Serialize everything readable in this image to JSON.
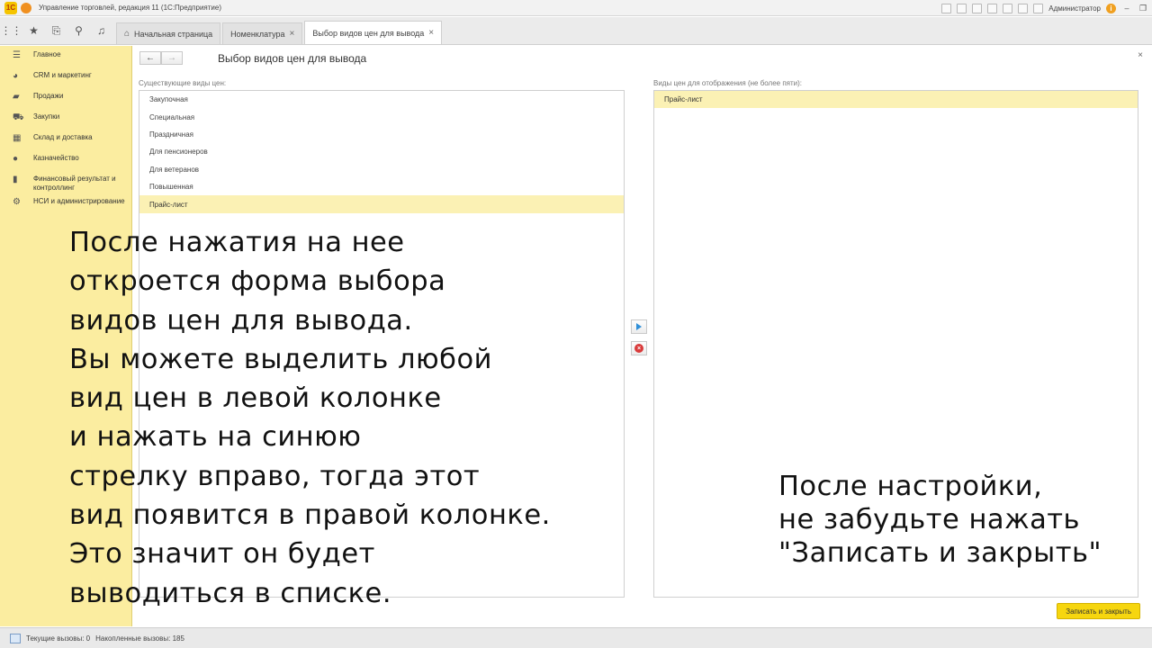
{
  "window": {
    "logo_text": "1C",
    "title": "Управление торговлей, редакция 11  (1С:Предприятие)",
    "user": "Администратор"
  },
  "tabs": [
    {
      "label": "Начальная страница"
    },
    {
      "label": "Номенклатура"
    },
    {
      "label": "Выбор видов цен для вывода"
    }
  ],
  "sidebar": {
    "items": [
      {
        "icon": "menu-icon",
        "label": "Главное"
      },
      {
        "icon": "crm-icon",
        "label": "CRM и маркетинг"
      },
      {
        "icon": "sales-icon",
        "label": "Продажи"
      },
      {
        "icon": "purchases-icon",
        "label": "Закупки"
      },
      {
        "icon": "warehouse-icon",
        "label": "Склад и доставка"
      },
      {
        "icon": "treasury-icon",
        "label": "Казначейство"
      },
      {
        "icon": "finance-chart-icon",
        "label": "Финансовый результат и контроллинг"
      },
      {
        "icon": "settings-gear-icon",
        "label": "НСИ и администрирование"
      }
    ]
  },
  "form": {
    "title": "Выбор видов цен для вывода",
    "left_label": "Существующие виды цен:",
    "right_label": "Виды цен для отображения (не более пяти):",
    "existing_prices": [
      "Закупочная",
      "Специальная",
      "Праздничная",
      "Для пенсионеров",
      "Для ветеранов",
      "Повышенная",
      "Прайс-лист"
    ],
    "selected_existing_index": 6,
    "display_prices": [
      "Прайс-лист"
    ],
    "save_label": "Записать и закрыть"
  },
  "captions": {
    "left": "После нажатия на нее\nоткроется форма выбора\nвидов цен для вывода.\nВы можете выделить любой\nвид цен в левой колонке\nи нажать на синюю\nстрелку вправо, тогда этот\nвид появится в правой колонке.\nЭто значит он  будет\nвыводиться в списке.",
    "right": "После настройки,\nне забудьте нажать\n\"Записать и закрыть\""
  },
  "status": {
    "current_calls": "Текущие вызовы: 0",
    "accumulated_calls": "Накопленные вызовы: 185"
  },
  "colors": {
    "sidebar_bg": "#fbeda0",
    "selection": "#fbf1b4",
    "save_button": "#f6d60f",
    "arrow_blue": "#2f8fd8",
    "delete_red": "#d93b3b"
  }
}
